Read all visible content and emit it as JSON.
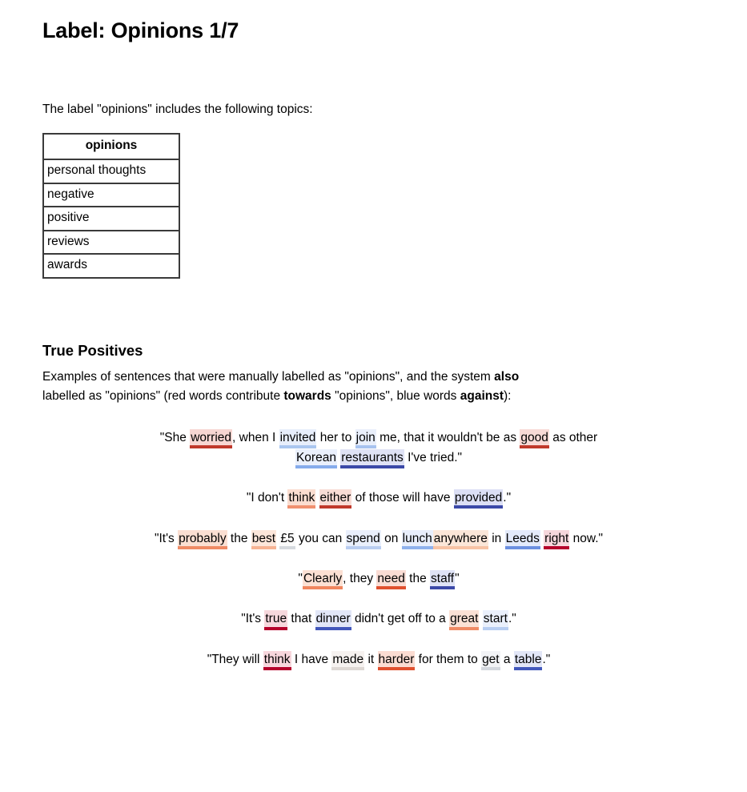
{
  "page": {
    "title": "Label: Opinions 1/7",
    "intro": "The label \"opinions\" includes the following topics:"
  },
  "topics_table": {
    "header": "opinions",
    "rows": [
      "personal thoughts",
      "negative",
      "positive",
      "reviews",
      "awards"
    ]
  },
  "true_positives": {
    "heading": "True Positives",
    "description_parts": [
      {
        "text": "Examples of sentences that were manually labelled as \"opinions\", and the system ",
        "bold": false
      },
      {
        "text": "also",
        "bold": true
      },
      {
        "text": " labelled as \"opinions\" (red words contribute ",
        "bold": false
      },
      {
        "text": "towards",
        "bold": true
      },
      {
        "text": " \"opinions\", blue words ",
        "bold": false
      },
      {
        "text": "against",
        "bold": true
      },
      {
        "text": "):",
        "bold": false
      }
    ],
    "legend": {
      "towards_color": "#c62828",
      "against_color": "#3949ab"
    },
    "examples": [
      {
        "id": "example-1",
        "tokens": [
          {
            "text": "\"She ",
            "hl": false
          },
          {
            "text": "worried",
            "hl": true,
            "bg": "#f7d6d2",
            "bar": "#c0392b"
          },
          {
            "text": ", when I ",
            "hl": false
          },
          {
            "text": "invited",
            "hl": true,
            "bg": "#e7eefb",
            "bar": "#aac6ef"
          },
          {
            "text": " her to ",
            "hl": false
          },
          {
            "text": "join",
            "hl": true,
            "bg": "#e9effb",
            "bar": "#a8c3ef"
          },
          {
            "text": " me, that it wouldn't be as ",
            "hl": false
          },
          {
            "text": "good",
            "hl": true,
            "bg": "#f8dad6",
            "bar": "#c0392b"
          },
          {
            "text": " as other",
            "hl": false
          }
        ]
      },
      {
        "id": "example-1-line2",
        "tokens": [
          {
            "text": "",
            "hl": false
          },
          {
            "text": "Korean",
            "hl": true,
            "bg": "#eaf0fc",
            "bar": "#86acec"
          },
          {
            "text": " ",
            "hl": false
          },
          {
            "text": "restaurants",
            "hl": true,
            "bg": "#dfe2f5",
            "bar": "#3b49a8"
          },
          {
            "text": " I've tried.\"",
            "hl": false
          }
        ]
      },
      {
        "id": "example-2",
        "tokens": [
          {
            "text": "\"I don't ",
            "hl": false
          },
          {
            "text": "think",
            "hl": true,
            "bg": "#fbddd0",
            "bar": "#f09170"
          },
          {
            "text": " ",
            "hl": false
          },
          {
            "text": "either",
            "hl": true,
            "bg": "#f8dcd5",
            "bar": "#c0392b"
          },
          {
            "text": " of those will have ",
            "hl": false
          },
          {
            "text": "provided",
            "hl": true,
            "bg": "#dcdff5",
            "bar": "#3b49a8"
          },
          {
            "text": ".\"",
            "hl": false
          }
        ]
      },
      {
        "id": "example-3",
        "tokens": [
          {
            "text": "\"It's ",
            "hl": false
          },
          {
            "text": "probably",
            "hl": true,
            "bg": "#fbdfd2",
            "bar": "#ef8b65"
          },
          {
            "text": " the ",
            "hl": false
          },
          {
            "text": "best",
            "hl": true,
            "bg": "#fce6da",
            "bar": "#f6b393"
          },
          {
            "text": " ",
            "hl": false
          },
          {
            "text": "£5",
            "hl": true,
            "bg": "#fafafa",
            "bar": "#d5d9de"
          },
          {
            "text": " you can ",
            "hl": false
          },
          {
            "text": "spend",
            "hl": true,
            "bg": "#e9effc",
            "bar": "#b9cdf0"
          },
          {
            "text": " on ",
            "hl": false
          },
          {
            "text": "lunch",
            "hl": true,
            "bg": "#e8eefc",
            "bar": "#8fb1ec"
          },
          {
            "text": " anywhere",
            "hl": false,
            "skip": true
          },
          {
            "text": "anywhere",
            "hl": true,
            "bg": "#fbe6d8",
            "bar": "#f7c3a5"
          },
          {
            "text": " in ",
            "hl": false
          },
          {
            "text": "Leeds",
            "hl": true,
            "bg": "#e3eafb",
            "bar": "#6b8fe0"
          },
          {
            "text": " ",
            "hl": false
          },
          {
            "text": "right",
            "hl": true,
            "bg": "#f6d7dc",
            "bar": "#b5002b"
          },
          {
            "text": " now.\"",
            "hl": false
          }
        ]
      },
      {
        "id": "example-4",
        "tokens": [
          {
            "text": "\"",
            "hl": false
          },
          {
            "text": "Clearly",
            "hl": true,
            "bg": "#fce0d3",
            "bar": "#f0865f"
          },
          {
            "text": ", they ",
            "hl": false
          },
          {
            "text": "need",
            "hl": true,
            "bg": "#fadcd4",
            "bar": "#e0502f"
          },
          {
            "text": " the ",
            "hl": false
          },
          {
            "text": "staff",
            "hl": true,
            "bg": "#dfe3f6",
            "bar": "#3b49a8"
          },
          {
            "text": "\"",
            "hl": false
          }
        ]
      },
      {
        "id": "example-5",
        "tokens": [
          {
            "text": "\"It's ",
            "hl": false
          },
          {
            "text": "true",
            "hl": true,
            "bg": "#f7d8dd",
            "bar": "#b5002b"
          },
          {
            "text": " that ",
            "hl": false
          },
          {
            "text": "dinner",
            "hl": true,
            "bg": "#e2e7f8",
            "bar": "#4257bb"
          },
          {
            "text": " didn't get off to a ",
            "hl": false
          },
          {
            "text": "great",
            "hl": true,
            "bg": "#fbe1d5",
            "bar": "#ef8b65"
          },
          {
            "text": " ",
            "hl": false
          },
          {
            "text": "start",
            "hl": true,
            "bg": "#eaf0fc",
            "bar": "#b7cdf1"
          },
          {
            "text": ".\"",
            "hl": false
          }
        ]
      },
      {
        "id": "example-6",
        "tokens": [
          {
            "text": "\"They will ",
            "hl": false
          },
          {
            "text": "think",
            "hl": true,
            "bg": "#f7d6dc",
            "bar": "#b5002b"
          },
          {
            "text": " I have ",
            "hl": false
          },
          {
            "text": "made",
            "hl": true,
            "bg": "#f6f2f0",
            "bar": "#ded8d4"
          },
          {
            "text": " it ",
            "hl": false
          },
          {
            "text": "harder",
            "hl": true,
            "bg": "#fbdcd2",
            "bar": "#e0502f"
          },
          {
            "text": " for them to ",
            "hl": false
          },
          {
            "text": "get",
            "hl": true,
            "bg": "#f2f3f6",
            "bar": "#d3d7de"
          },
          {
            "text": " a ",
            "hl": false
          },
          {
            "text": "table",
            "hl": true,
            "bg": "#e2e6f7",
            "bar": "#4257bb"
          },
          {
            "text": ".\"",
            "hl": false
          }
        ]
      }
    ]
  }
}
